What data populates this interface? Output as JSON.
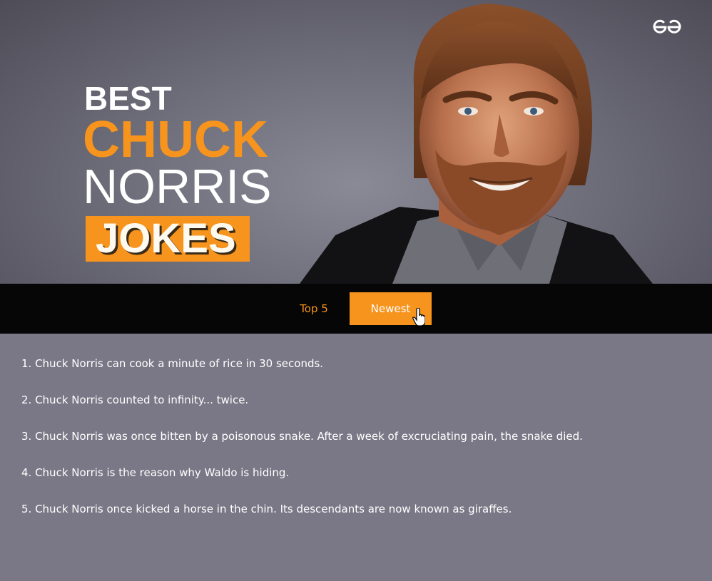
{
  "hero": {
    "title_line1": "BEST",
    "title_line2": "CHUCK",
    "title_line3": "NORRIS",
    "title_line4": "JOKES",
    "logo_icon": "geeksforgeeks-logo-icon",
    "accent_color": "#f7941d"
  },
  "nav": {
    "top5_label": "Top 5",
    "newest_label": "Newest",
    "active_tab": "Newest"
  },
  "jokes": [
    "1. Chuck Norris can cook a minute of rice in 30 seconds.",
    "2. Chuck Norris counted to infinity... twice.",
    "3. Chuck Norris was once bitten by a poisonous snake. After a week of excruciating pain, the snake died.",
    "4. Chuck Norris is the reason why Waldo is hiding.",
    "5. Chuck Norris once kicked a horse in the chin. Its descendants are now known as giraffes."
  ]
}
